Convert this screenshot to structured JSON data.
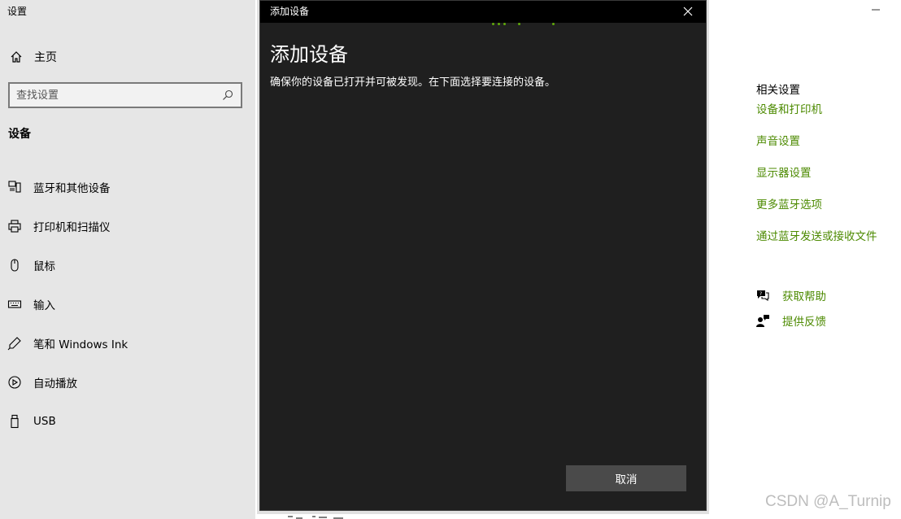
{
  "app": {
    "title": "设置"
  },
  "sidebar": {
    "home_label": "主页",
    "search_placeholder": "查找设置",
    "section_title": "设备",
    "items": [
      {
        "label": "蓝牙和其他设备",
        "icon": "bluetooth-devices-icon"
      },
      {
        "label": "打印机和扫描仪",
        "icon": "printer-icon"
      },
      {
        "label": "鼠标",
        "icon": "mouse-icon"
      },
      {
        "label": "输入",
        "icon": "keyboard-icon"
      },
      {
        "label": "笔和 Windows Ink",
        "icon": "pen-icon"
      },
      {
        "label": "自动播放",
        "icon": "autoplay-icon"
      },
      {
        "label": "USB",
        "icon": "usb-icon"
      }
    ]
  },
  "related": {
    "title": "相关设置",
    "links": [
      "设备和打印机",
      "声音设置",
      "显示器设置",
      "更多蓝牙选项",
      "通过蓝牙发送或接收文件"
    ]
  },
  "help": {
    "get_help": "获取帮助",
    "feedback": "提供反馈"
  },
  "dialog": {
    "window_title": "添加设备",
    "heading": "添加设备",
    "description": "确保你的设备已打开并可被发现。在下面选择要连接的设备。",
    "cancel_label": "取消"
  },
  "watermark": "CSDN @A_Turnip",
  "colors": {
    "sidebar_bg": "#e6e6e6",
    "dialog_bg": "#1f1f1f",
    "accent_link": "#4c8a00",
    "progress": "#5fa80a",
    "button_bg": "#4a4a4a"
  }
}
